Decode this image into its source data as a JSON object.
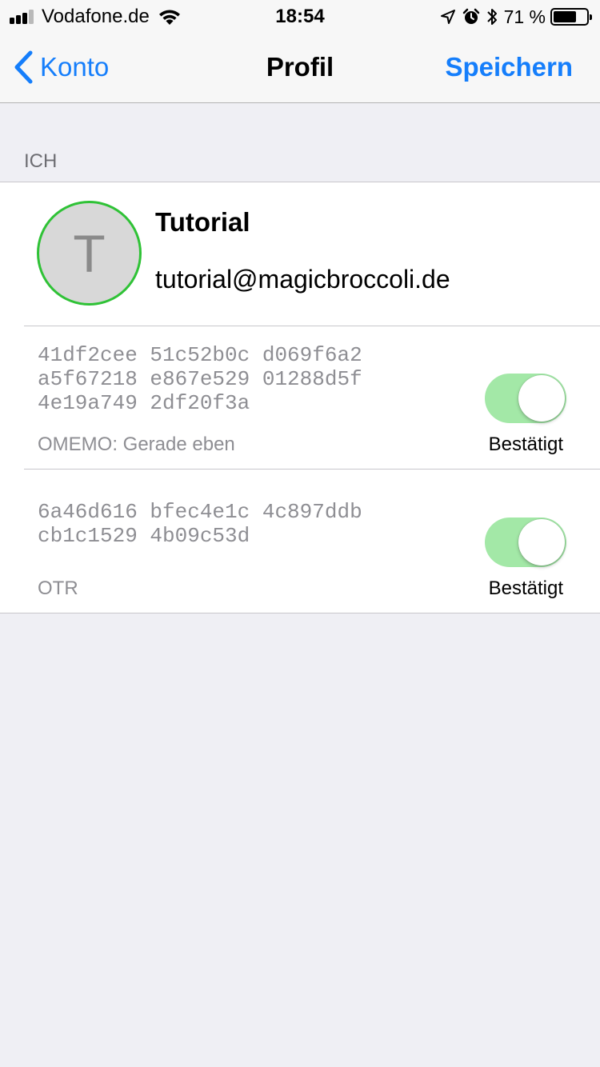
{
  "status_bar": {
    "carrier": "Vodafone.de",
    "signal_bars_active": 3,
    "signal_bars_total": 4,
    "time": "18:54",
    "battery_percent": "71 %",
    "battery_level": 0.71,
    "icons": [
      "location-arrow-icon",
      "alarm-icon",
      "bluetooth-icon"
    ]
  },
  "nav": {
    "back_label": "Konto",
    "title": "Profil",
    "save_label": "Speichern"
  },
  "section": {
    "header": "ICH"
  },
  "profile": {
    "avatar_initial": "T",
    "name": "Tutorial",
    "email": "tutorial@magicbroccoli.de"
  },
  "keys": [
    {
      "fingerprint_lines": [
        "41df2cee 51c52b0c d069f6a2",
        "a5f67218 e867e529 01288d5f",
        "4e19a749 2df20f3a"
      ],
      "meta": "OMEMO: Gerade eben",
      "toggle_label": "Bestätigt",
      "verified": true
    },
    {
      "fingerprint_lines": [
        "6a46d616 bfec4e1c 4c897ddb",
        "cb1c1529 4b09c53d"
      ],
      "meta": "OTR",
      "toggle_label": "Bestätigt",
      "verified": true
    }
  ],
  "colors": {
    "accent": "#157efb",
    "avatar_ring": "#2fc236",
    "toggle_on": "#a3e8a7",
    "background": "#efeff4"
  }
}
